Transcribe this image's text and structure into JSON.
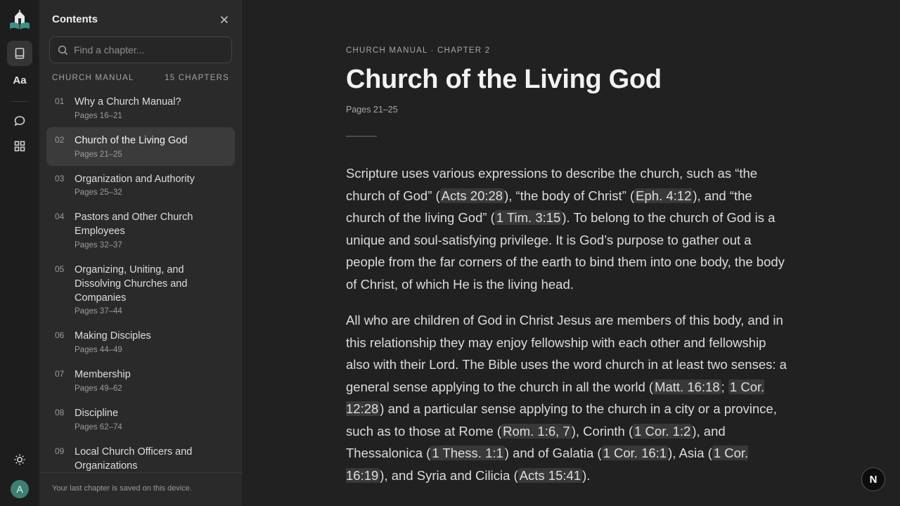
{
  "rail": {
    "logo_icon": "church-book-logo-icon",
    "items": [
      {
        "name": "book-icon",
        "active": true
      },
      {
        "name": "typography-aa",
        "label": "Aa"
      },
      {
        "name": "chat-icon"
      },
      {
        "name": "grid-icon"
      }
    ],
    "theme_icon": "sun-icon",
    "avatar_initial": "A",
    "avatar_color": "#3e7f73"
  },
  "sidebar": {
    "title": "Contents",
    "search_placeholder": "Find a chapter...",
    "section_label": "CHURCH MANUAL",
    "section_count": "15 CHAPTERS",
    "chapters": [
      {
        "num": "01",
        "title": "Why a Church Manual?",
        "pages": "Pages 16–21"
      },
      {
        "num": "02",
        "title": "Church of the Living God",
        "pages": "Pages 21–25"
      },
      {
        "num": "03",
        "title": "Organization and Authority",
        "pages": "Pages 25–32"
      },
      {
        "num": "04",
        "title": "Pastors and Other Church Employees",
        "pages": "Pages 32–37"
      },
      {
        "num": "05",
        "title": "Organizing, Uniting, and Dissolving Churches and Companies",
        "pages": "Pages 37–44"
      },
      {
        "num": "06",
        "title": "Making Disciples",
        "pages": "Pages 44–49"
      },
      {
        "num": "07",
        "title": "Membership",
        "pages": "Pages 49–62"
      },
      {
        "num": "08",
        "title": "Discipline",
        "pages": "Pages 62–74"
      },
      {
        "num": "09",
        "title": "Local Church Officers and Organizations",
        "pages": ""
      }
    ],
    "active_chapter": "02",
    "footer": "Your last chapter is saved on this device."
  },
  "main": {
    "eyebrow": "CHURCH MANUAL · CHAPTER 2",
    "title": "Church of the Living God",
    "pages": "Pages 21–25",
    "p1": {
      "t1": "Scripture uses various expressions to describe the church, such as “the church of God” (",
      "r1": "Acts 20:28",
      "t2": "), “the body of Christ” (",
      "r2": "Eph. 4:12",
      "t3": "), and “the church of the living God” (",
      "r3": "1 Tim. 3:15",
      "t4": "). To belong to the church of God is a unique and soul-satisfying privilege. It is God’s purpose to gather out a people from the far corners of the earth to bind them into one body, the body of Christ, of which He is the living head."
    },
    "p2": {
      "t1": "All who are children of God in Christ Jesus are members of this body, and in this relationship they may enjoy fellowship with each other and fellowship also with their Lord. The Bible uses the word church in at least two senses: a general sense applying to the church in all the world (",
      "r1": "Matt. 16:18",
      "t2": "; ",
      "r2": "1 Cor. 12:28",
      "t3": ") and a particular sense applying to the church in a city or a province, such as to those at Rome (",
      "r3": "Rom. 1:6, 7",
      "t4": "), Corinth (",
      "r4": "1 Cor. 1:2",
      "t5": "), and Thessalonica (",
      "r5": "1 Thess. 1:1",
      "t6": ") and of Galatia (",
      "r6": "1 Cor. 16:1",
      "t7": "), Asia (",
      "r7": "1 Cor. 16:19",
      "t8": "), and Syria and Cilicia (",
      "r8": "Acts 15:41",
      "t9": ")."
    }
  },
  "fab_label": "N"
}
